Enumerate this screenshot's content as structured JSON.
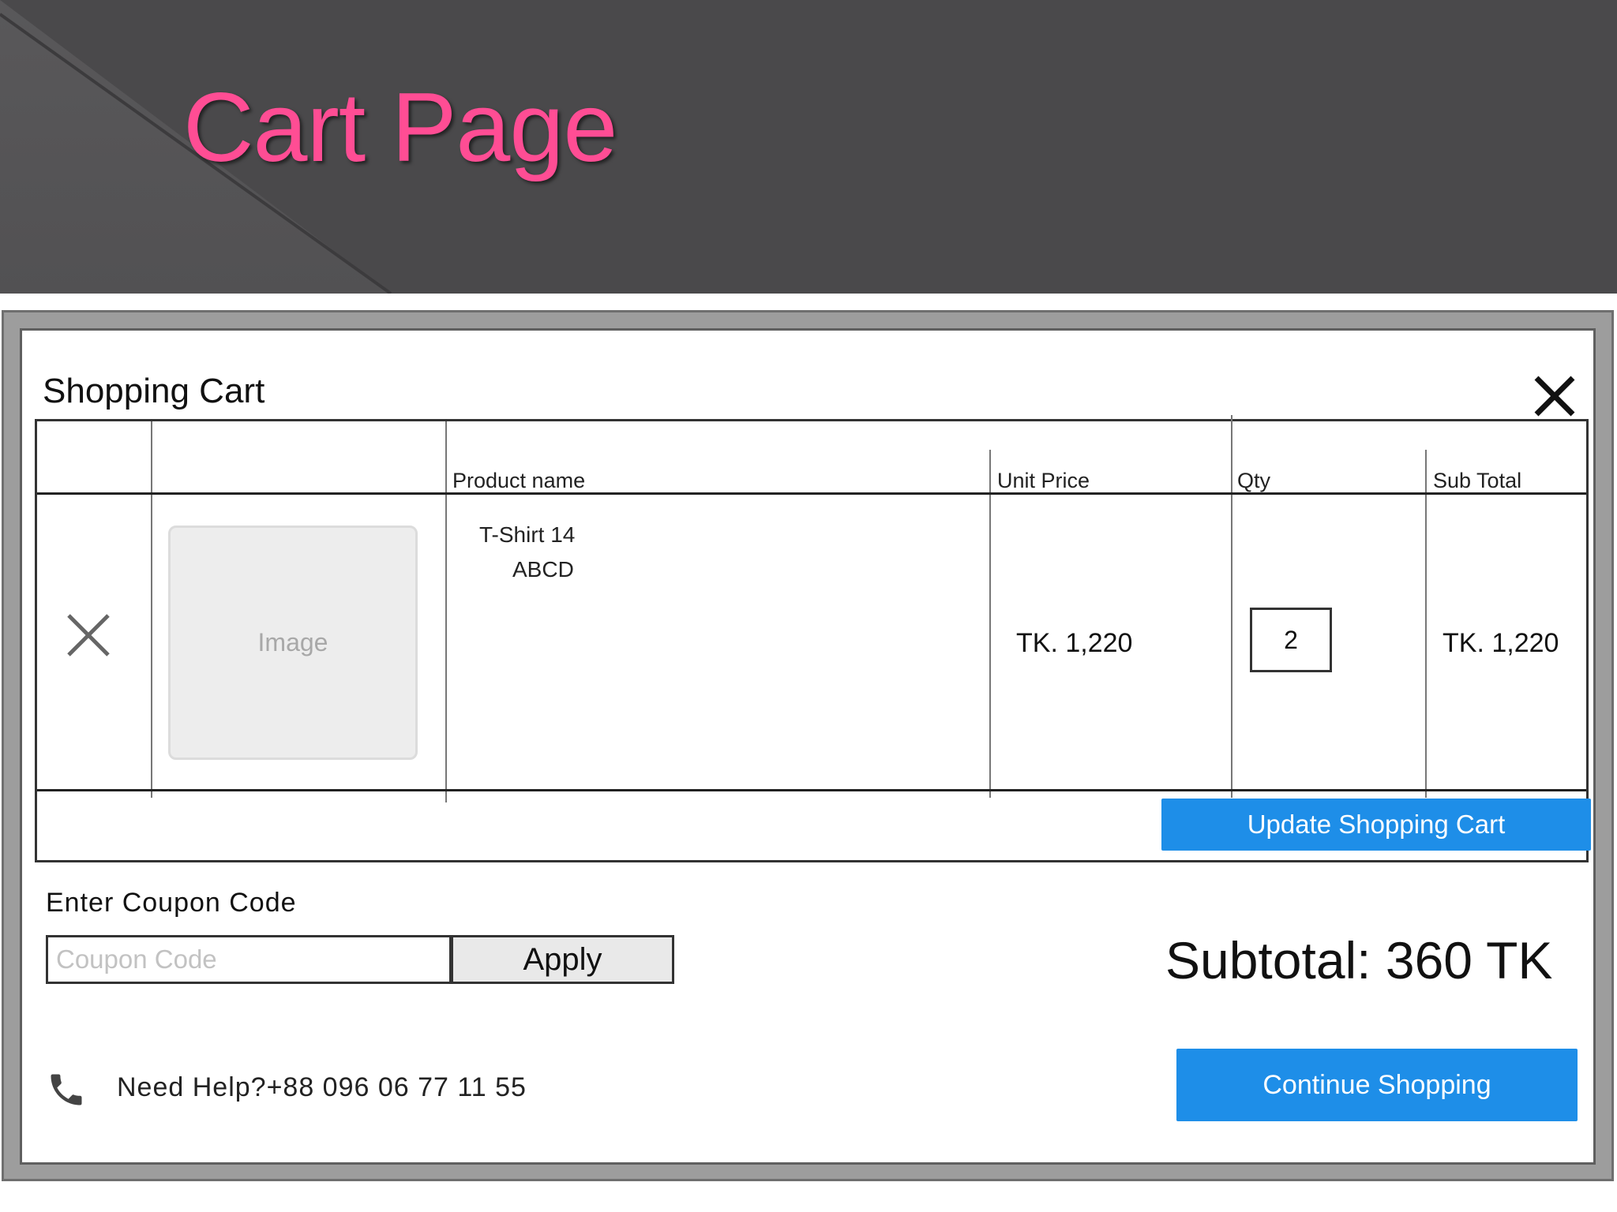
{
  "slide": {
    "title": "Cart Page"
  },
  "cart": {
    "title": "Shopping Cart",
    "columns": {
      "product_name": "Product name",
      "unit_price": "Unit Price",
      "qty": "Qty",
      "sub_total": "Sub Total"
    },
    "item": {
      "image_label": "Image",
      "name_line1": "T-Shirt 14",
      "name_line2": "ABCD",
      "unit_price": "TK. 1,220",
      "qty": "2",
      "sub_total": "TK. 1,220"
    },
    "update_label": "Update Shopping Cart"
  },
  "coupon": {
    "label": "Enter Coupon Code",
    "placeholder": "Coupon Code",
    "apply_label": "Apply"
  },
  "totals": {
    "subtotal": "Subtotal: 360 TK"
  },
  "footer": {
    "help_text": "Need Help?+88 096 06 77 11 55",
    "continue_label": "Continue Shopping"
  },
  "colors": {
    "title_pink": "#ff4d94",
    "button_blue": "#1e8ee8",
    "header_bg": "#4a494b"
  },
  "icons": {
    "close": "close-icon",
    "remove": "remove-item-icon",
    "phone": "phone-icon"
  }
}
